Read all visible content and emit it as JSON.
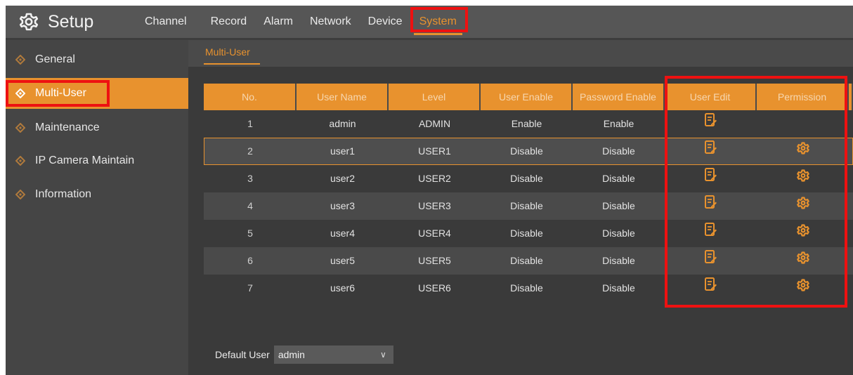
{
  "app": {
    "title": "Setup",
    "tabs": [
      {
        "label": "Channel"
      },
      {
        "label": "Record"
      },
      {
        "label": "Alarm"
      },
      {
        "label": "Network"
      },
      {
        "label": "Device"
      },
      {
        "label": "System",
        "active": true
      }
    ]
  },
  "sidebar": {
    "items": [
      {
        "label": "General"
      },
      {
        "label": "Multi-User",
        "active": true
      },
      {
        "label": "Maintenance"
      },
      {
        "label": "IP Camera Maintain"
      },
      {
        "label": "Information"
      }
    ]
  },
  "main": {
    "subtab": "Multi-User",
    "table": {
      "headers": [
        "No.",
        "User Name",
        "Level",
        "User Enable",
        "Password Enable",
        "User Edit",
        "Permission"
      ],
      "rows": [
        {
          "no": "1",
          "name": "admin",
          "level": "ADMIN",
          "user_enable": "Enable",
          "password_enable": "Enable",
          "edit_icon": "edit-icon",
          "permission_icon": ""
        },
        {
          "no": "2",
          "name": "user1",
          "level": "USER1",
          "user_enable": "Disable",
          "password_enable": "Disable",
          "edit_icon": "edit-icon",
          "permission_icon": "gear-icon",
          "selected": true
        },
        {
          "no": "3",
          "name": "user2",
          "level": "USER2",
          "user_enable": "Disable",
          "password_enable": "Disable",
          "edit_icon": "edit-icon",
          "permission_icon": "gear-icon"
        },
        {
          "no": "4",
          "name": "user3",
          "level": "USER3",
          "user_enable": "Disable",
          "password_enable": "Disable",
          "edit_icon": "edit-icon",
          "permission_icon": "gear-icon"
        },
        {
          "no": "5",
          "name": "user4",
          "level": "USER4",
          "user_enable": "Disable",
          "password_enable": "Disable",
          "edit_icon": "edit-icon",
          "permission_icon": "gear-icon"
        },
        {
          "no": "6",
          "name": "user5",
          "level": "USER5",
          "user_enable": "Disable",
          "password_enable": "Disable",
          "edit_icon": "edit-icon",
          "permission_icon": "gear-icon"
        },
        {
          "no": "7",
          "name": "user6",
          "level": "USER6",
          "user_enable": "Disable",
          "password_enable": "Disable",
          "edit_icon": "edit-icon",
          "permission_icon": "gear-icon"
        }
      ]
    },
    "default_user": {
      "label": "Default User",
      "value": "admin"
    }
  },
  "colors": {
    "accent": "#e8922e",
    "highlight": "#ee1111",
    "topbar": "#565656",
    "sidebar": "#454545"
  }
}
